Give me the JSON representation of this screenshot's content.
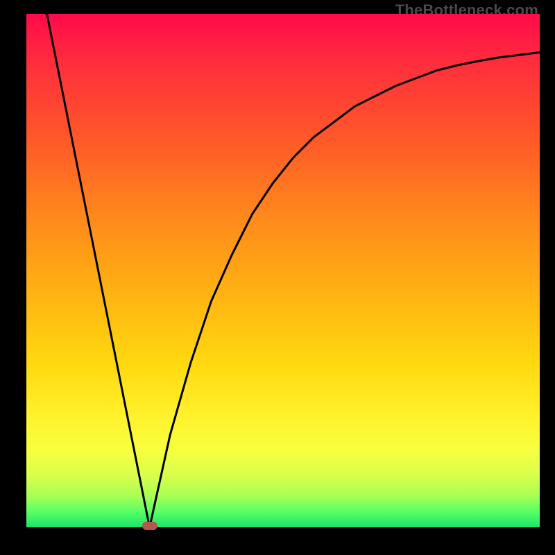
{
  "watermark": "TheBottleneck.com",
  "chart_data": {
    "type": "line",
    "title": "",
    "xlabel": "",
    "ylabel": "",
    "xlim": [
      0,
      100
    ],
    "ylim": [
      0,
      100
    ],
    "grid": false,
    "legend": false,
    "description": "V-shaped bottleneck curve with a single minimum near x≈24. Vertical axis encodes bottleneck severity mapped to a red→green color gradient (high = red at top, low = green at bottom).",
    "minimum": {
      "x": 24,
      "y": 0
    },
    "series": [
      {
        "name": "bottleneck-curve",
        "x": [
          4,
          8,
          12,
          16,
          20,
          24,
          28,
          32,
          36,
          40,
          44,
          48,
          52,
          56,
          60,
          64,
          68,
          72,
          76,
          80,
          84,
          88,
          92,
          96,
          100
        ],
        "values": [
          100,
          80,
          60,
          40,
          20,
          0,
          18,
          32,
          44,
          53,
          61,
          67,
          72,
          76,
          79,
          82,
          84,
          86,
          87.5,
          89,
          90,
          90.8,
          91.5,
          92,
          92.5
        ]
      }
    ],
    "gradient_stops": [
      {
        "pos": 0,
        "color": "#ff0a4a"
      },
      {
        "pos": 25,
        "color": "#ff5a28"
      },
      {
        "pos": 55,
        "color": "#ffb412"
      },
      {
        "pos": 78,
        "color": "#fff12b"
      },
      {
        "pos": 94,
        "color": "#a8ff55"
      },
      {
        "pos": 100,
        "color": "#18e66a"
      }
    ],
    "marker": {
      "color": "#b6564c",
      "shape": "rounded-rect"
    }
  }
}
